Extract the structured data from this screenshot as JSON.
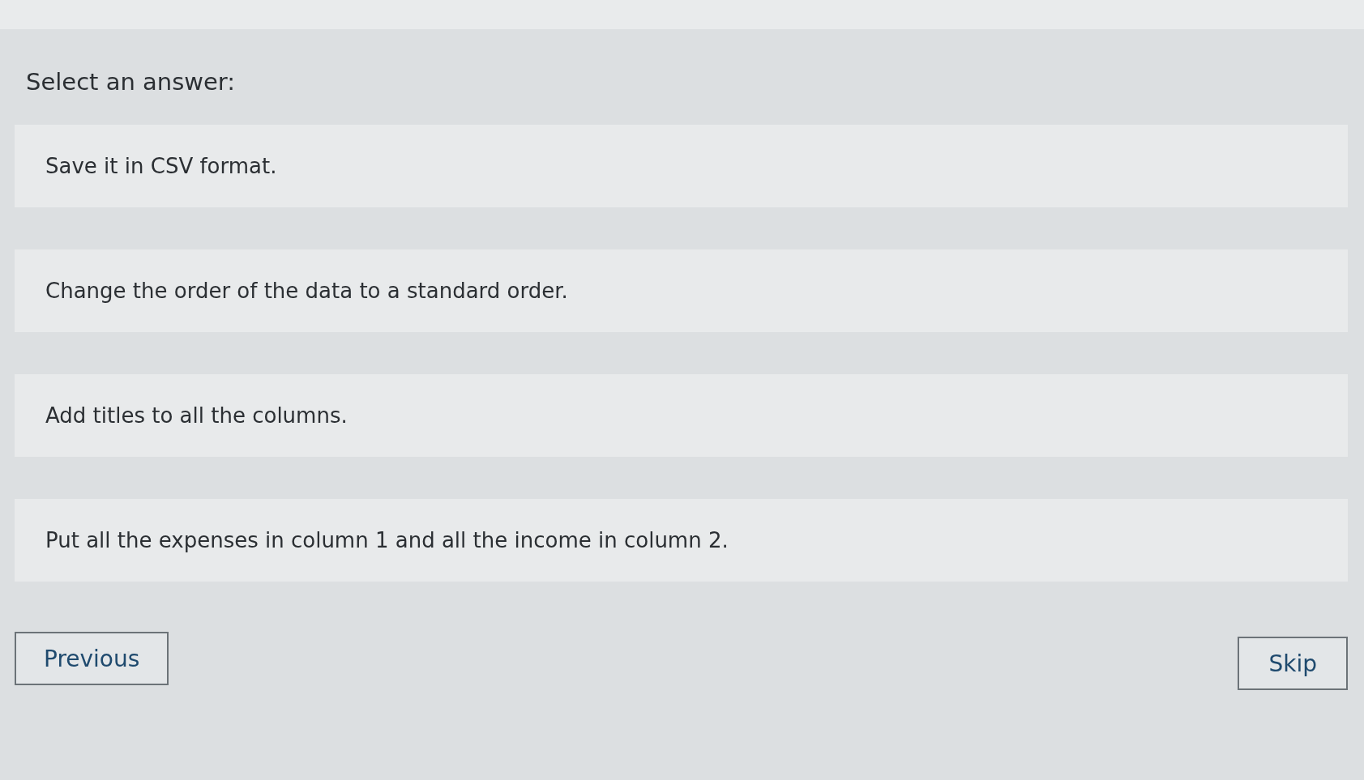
{
  "prompt": "Select an answer:",
  "options": [
    {
      "label": "Save it in CSV format.",
      "selected": false
    },
    {
      "label": "Change the order of the data to a standard order.",
      "selected": false
    },
    {
      "label": "Add titles to all the columns.",
      "selected": false
    },
    {
      "label": "Put all the expenses in column 1 and all the income in column 2.",
      "selected": false
    }
  ],
  "buttons": {
    "previous": "Previous",
    "skip": "Skip"
  }
}
